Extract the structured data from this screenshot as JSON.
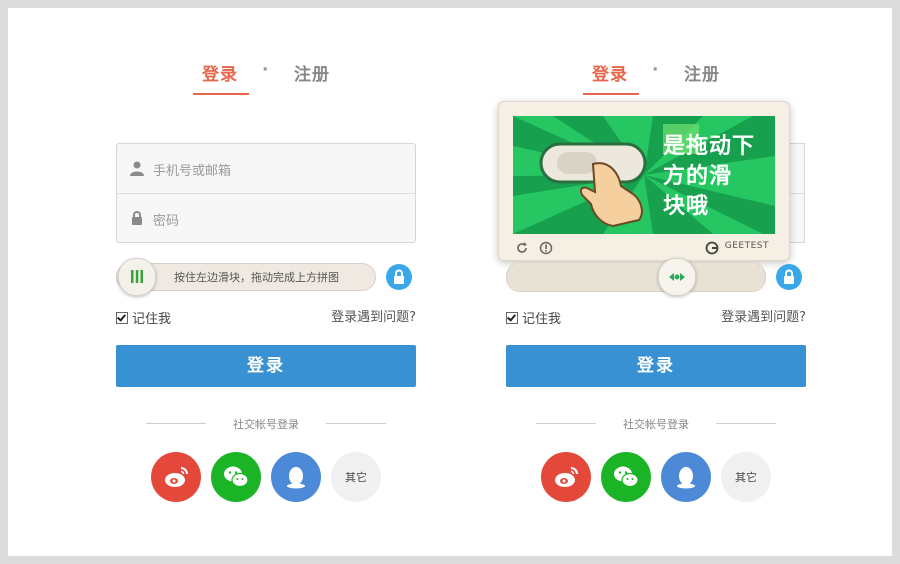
{
  "tabs": {
    "login": "登录",
    "separator": "·",
    "register": "注册"
  },
  "form": {
    "account_placeholder": "手机号或邮箱",
    "password_placeholder": "密码",
    "slider_hint": "按住左边滑块，拖动完成上方拼图",
    "remember_label": "记住我",
    "problem_link": "登录遇到问题?",
    "login_button": "登录"
  },
  "social": {
    "label": "社交帐号登录",
    "other_label": "其它",
    "colors": {
      "weibo": "#e4483a",
      "wechat": "#1bb426",
      "qq": "#4c8ad8",
      "other": "#f0f0f0"
    }
  },
  "captcha": {
    "image_text_line1": "是拖动下",
    "image_text_line2": "方的滑",
    "image_text_line3": "块哦",
    "brand": "GEETEST"
  },
  "colors": {
    "accent": "#e8674c",
    "primary": "#3791d3",
    "lock": "#3aa8e8"
  },
  "icons": [
    "user-icon",
    "lock-icon",
    "slider-grip-icon",
    "padlock-icon",
    "weibo-icon",
    "wechat-icon",
    "qq-icon",
    "refresh-icon",
    "info-icon",
    "geetest-logo-icon",
    "slider-arrows-icon"
  ]
}
